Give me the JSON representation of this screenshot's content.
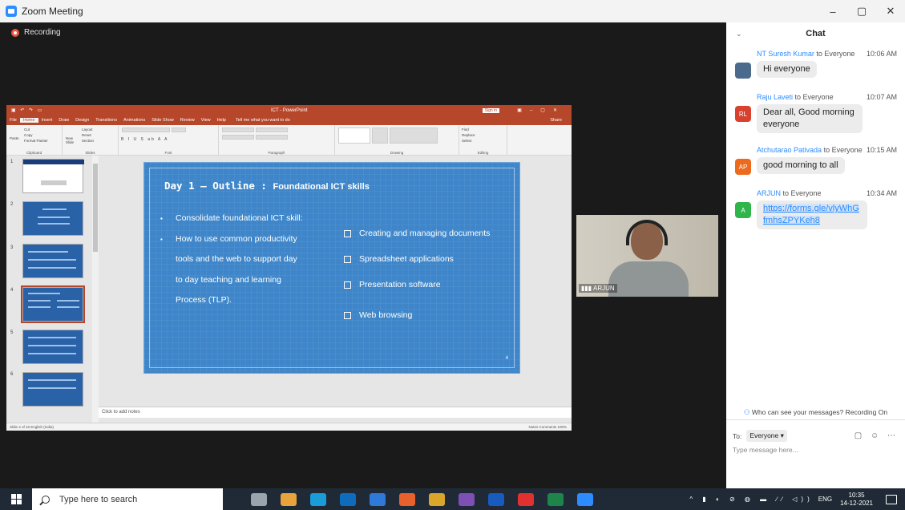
{
  "window": {
    "title": "Zoom Meeting",
    "controls": [
      "–",
      "▢",
      "✕"
    ]
  },
  "recording": {
    "label": "Recording"
  },
  "powerpoint": {
    "title": "ICT - PowerPoint",
    "sign_in": "Sign in",
    "tabs": [
      "File",
      "Home",
      "Insert",
      "Draw",
      "Design",
      "Transitions",
      "Animations",
      "Slide Show",
      "Review",
      "View",
      "Help"
    ],
    "tell_me": "Tell me what you want to do",
    "share": "Share",
    "ribbon_groups": [
      "Clipboard",
      "Slides",
      "Font",
      "Paragraph",
      "Drawing",
      "Editing"
    ],
    "clipboard": {
      "paste": "Paste",
      "cut": "Cut",
      "copy": "Copy",
      "format_painter": "Format Painter"
    },
    "slides": {
      "new_slide": "New Slide",
      "layout": "Layout",
      "reset": "Reset",
      "section": "Section"
    },
    "editing": {
      "find": "Find",
      "replace": "Replace",
      "select": "Select"
    },
    "thumb_numbers": [
      "1",
      "2",
      "3",
      "4",
      "5",
      "6"
    ],
    "notes_placeholder": "Click to add notes",
    "status_left": "Slide 4 of 16    English (India)",
    "status_right": "Notes    Comments          100%"
  },
  "slide": {
    "title_mono": "Day 1 – Outline :",
    "title_bold": "Foundational ICT skills",
    "left_items": [
      {
        "text": "Consolidate foundational ICT skill:"
      },
      {
        "text": "How to use common productivity",
        "cont": [
          "tools and the web to support day",
          "to  day  teaching  and  learning",
          "Process (TLP)."
        ]
      }
    ],
    "right_items": [
      "Creating and managing documents",
      "Spreadsheet applications",
      "Presentation software",
      "Web browsing"
    ],
    "number": "4"
  },
  "video": {
    "participant_name": "ARJUN"
  },
  "chat": {
    "header": "Chat",
    "messages": [
      {
        "from": "NT Suresh Kumar",
        "to": "to Everyone",
        "time": "10:06 AM",
        "avatar": "",
        "avatar_color": "#4b6a8c",
        "text": "Hi everyone"
      },
      {
        "from": "Raju Laveti",
        "to": "to Everyone",
        "time": "10:07 AM",
        "avatar": "RL",
        "avatar_color": "#d9412f",
        "text": "Dear all, Good morning everyone"
      },
      {
        "from": "Atchutarao Pativada",
        "to": "to Everyone",
        "time": "10:15 AM",
        "avatar": "AP",
        "avatar_color": "#ec6a1e",
        "text": "good morning to all"
      },
      {
        "from": "ARJUN",
        "to": "to Everyone",
        "time": "10:34 AM",
        "avatar": "A",
        "avatar_color": "#2fb54a",
        "text": "https://forms.gle/vlyWhGfmhsZPYKeh8"
      }
    ],
    "visibility_note": "Who can see your messages? Recording On",
    "to_label": "To:",
    "recipient": "Everyone ▾",
    "input_placeholder": "Type message here..."
  },
  "taskbar": {
    "search_placeholder": "Type here to search",
    "app_colors": [
      "#9aa4ad",
      "#e8a33d",
      "#1a9cd8",
      "#0f6cbd",
      "#2f7ad8",
      "#e8602c",
      "#d9a52b",
      "#7e4fb5",
      "#185abd",
      "#e03030",
      "#1e8449",
      "#2d8cff"
    ],
    "tray_symbols": "^ ▮ ◐ ⊘ ◍ ▬ ∕∕ ◁))",
    "language": "ENG",
    "time": "10:35",
    "date": "14-12-2021"
  }
}
